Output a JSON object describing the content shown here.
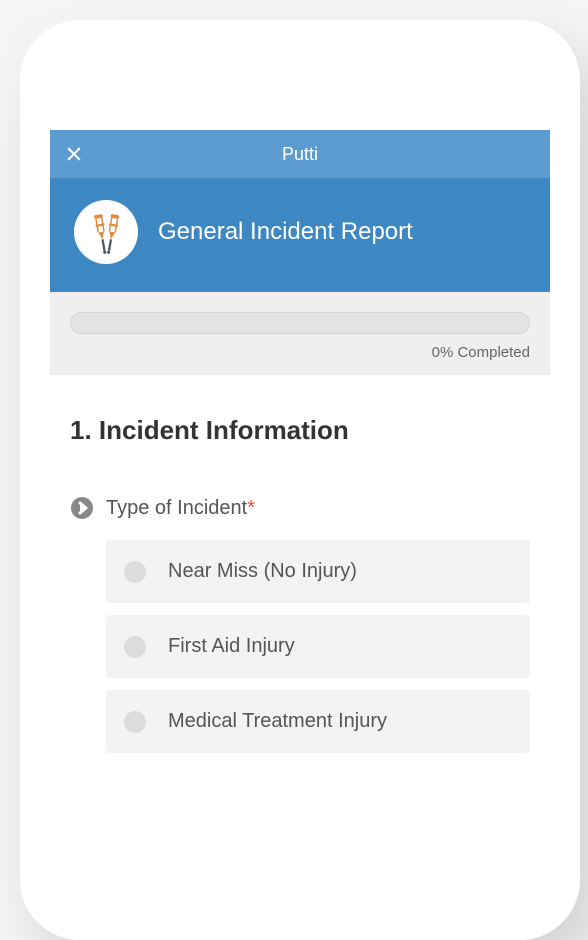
{
  "topBar": {
    "title": "Putti"
  },
  "header": {
    "title": "General Incident Report",
    "icon": "crutches-icon"
  },
  "progress": {
    "percent": 0,
    "label": "0% Completed"
  },
  "section": {
    "heading": "1. Incident Information"
  },
  "question": {
    "label": "Type of Incident",
    "required": "*",
    "options": [
      {
        "label": "Near Miss (No Injury)"
      },
      {
        "label": "First Aid Injury"
      },
      {
        "label": "Medical Treatment Injury"
      }
    ]
  }
}
